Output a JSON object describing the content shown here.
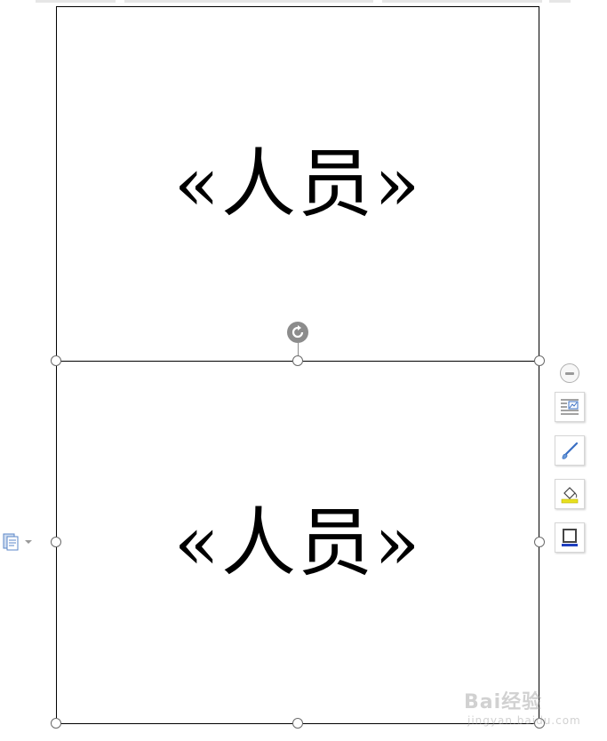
{
  "label_cells": [
    {
      "merge_field": "«人员»"
    },
    {
      "merge_field": "«人员»"
    }
  ],
  "toolbar": {
    "collapse_icon": "minus-circle-icon",
    "layout_icon": "text-wrap-layout-icon",
    "style_icon": "brush-icon",
    "fill_icon": "fill-bucket-icon",
    "outline_icon": "shape-outline-icon"
  },
  "paste_options": {
    "icon": "paste-options-icon"
  },
  "watermark": {
    "brand": "Bai经验",
    "domain": "jingyan.baidu.com"
  },
  "colors": {
    "fill_accent": "#e8e020",
    "outline_accent": "#1f3fbf",
    "handle_gray": "#8c8c8c",
    "paste_icon": "#5b87c8"
  }
}
